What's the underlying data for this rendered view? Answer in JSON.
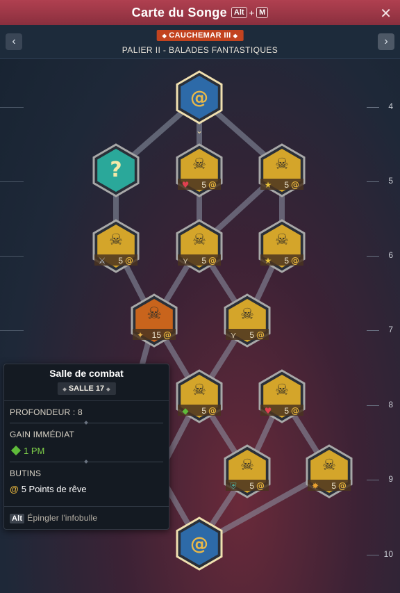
{
  "window": {
    "title": "Carte du Songe",
    "shortcut_mod": "Alt",
    "shortcut_plus": "+",
    "shortcut_key": "M",
    "close_icon": "close-icon"
  },
  "header": {
    "difficulty": "CAUCHEMAR III",
    "tier": "PALIER II - BALADES FANTASTIQUES",
    "prev_icon": "chevron-left-icon",
    "next_icon": "chevron-right-icon"
  },
  "depth_ruler": [
    "4",
    "5",
    "6",
    "7",
    "8",
    "9",
    "10"
  ],
  "colors": {
    "combat_hex": "#d4a52a",
    "elite_hex": "#c9641c",
    "mystery_hex": "#2aa89a",
    "dream_hex": "#2d6aa8",
    "selected_border": "#e6e6e6",
    "path": "#8e98a8"
  },
  "nodes": [
    {
      "id": "top",
      "kind": "dream",
      "icon": "dream-shop-icon"
    },
    {
      "id": "r5a",
      "kind": "mystery",
      "icon": "question-icon"
    },
    {
      "id": "r5b",
      "kind": "combat",
      "icon": "skull-icon",
      "reward_icon": "heart-icon",
      "points": "5"
    },
    {
      "id": "r5c",
      "kind": "combat",
      "icon": "skull-icon",
      "reward_icon": "star-icon",
      "points": "5"
    },
    {
      "id": "r6a",
      "kind": "combat",
      "icon": "skull-icon",
      "reward_icon": "sword-icon",
      "points": "5"
    },
    {
      "id": "r6b",
      "kind": "combat",
      "icon": "skull-icon",
      "reward_icon": "wings-icon",
      "points": "5"
    },
    {
      "id": "r6c",
      "kind": "combat",
      "icon": "skull-icon",
      "reward_icon": "star-icon",
      "points": "5"
    },
    {
      "id": "r7a",
      "kind": "elite",
      "icon": "horned-helmet-icon",
      "reward_icon": "wand-icon",
      "points": "15"
    },
    {
      "id": "r7b",
      "kind": "combat",
      "icon": "skull-icon",
      "reward_icon": "wings-icon",
      "points": "5"
    },
    {
      "id": "r8b",
      "kind": "combat",
      "icon": "skull-icon",
      "reward_icon": "gem-icon",
      "points": "5"
    },
    {
      "id": "r8c",
      "kind": "combat",
      "icon": "skull-icon",
      "reward_icon": "heart-icon",
      "points": "5"
    },
    {
      "id": "r9b",
      "kind": "combat",
      "icon": "skull-icon",
      "reward_icon": "shield-icon",
      "points": "5"
    },
    {
      "id": "r9c",
      "kind": "combat",
      "icon": "skull-icon",
      "reward_icon": "sun-icon",
      "points": "5"
    },
    {
      "id": "bottom",
      "kind": "dream",
      "icon": "dream-shop-icon"
    }
  ],
  "tooltip": {
    "title": "Salle de combat",
    "room": "SALLE 17",
    "depth_label": "PROFONDEUR : 8",
    "gain_label": "GAIN IMMÉDIAT",
    "gain_value": "1 PM",
    "gain_icon": "gem-icon",
    "loot_label": "BUTINS",
    "loot_value": "5 Points de rêve",
    "loot_icon": "dream-point-icon",
    "pin_key": "Alt",
    "pin_text": "Épingler l'infobulle"
  }
}
